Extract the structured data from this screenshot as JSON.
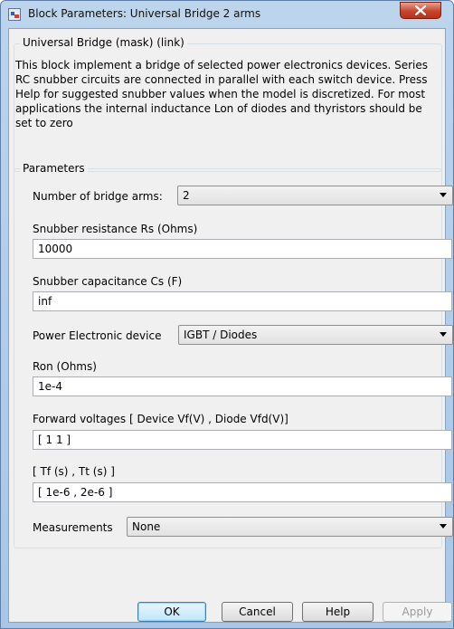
{
  "window": {
    "title": "Block Parameters: Universal Bridge 2 arms"
  },
  "description": {
    "legend": "Universal Bridge (mask) (link)",
    "text": "This block implement a bridge of selected power electronics devices. Series RC snubber circuits are connected in parallel with each switch device.  Press Help for suggested snubber values when the model is discretized. For most applications the internal inductance Lon of diodes and thyristors should be set to zero"
  },
  "parameters": {
    "legend": "Parameters",
    "bridge_arms": {
      "label": "Number of bridge arms:",
      "value": "2"
    },
    "rs": {
      "label": "Snubber resistance Rs (Ohms)",
      "value": "10000"
    },
    "cs": {
      "label": "Snubber capacitance Cs (F)",
      "value": "inf"
    },
    "device": {
      "label": "Power Electronic device",
      "value": "IGBT / Diodes"
    },
    "ron": {
      "label": "Ron (Ohms)",
      "value": "1e-4"
    },
    "vf": {
      "label": "Forward voltages  [ Device Vf(V) , Diode Vfd(V)]",
      "value": "[ 1  1 ]"
    },
    "tf": {
      "label": "[  Tf (s) , Tt (s)  ]",
      "value": "[ 1e-6 , 2e-6 ]"
    },
    "measurements": {
      "label": "Measurements",
      "value": "None"
    }
  },
  "buttons": {
    "ok": "OK",
    "cancel": "Cancel",
    "help": "Help",
    "apply": "Apply"
  }
}
